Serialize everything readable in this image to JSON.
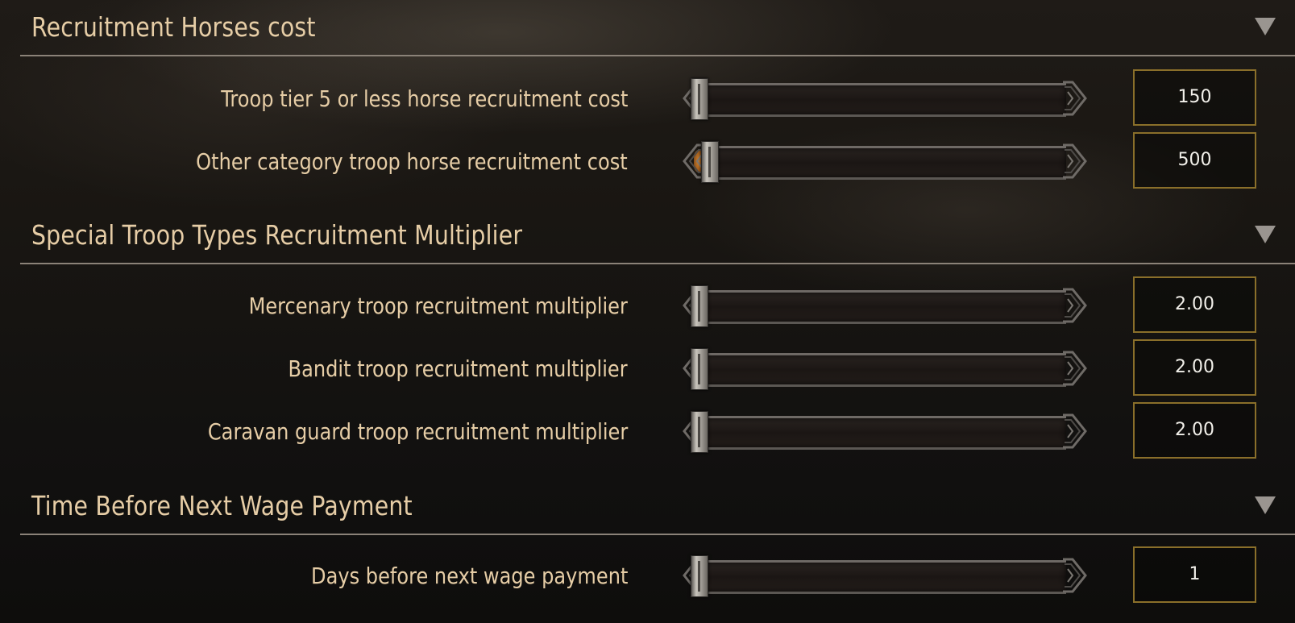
{
  "sections": [
    {
      "title": "Recruitment Horses cost",
      "rows": [
        {
          "label": "Troop tier 5 or less horse recruitment cost",
          "value": "150",
          "slider_fraction": 0.0
        },
        {
          "label": "Other category troop horse recruitment cost",
          "value": "500",
          "slider_fraction": 0.03
        }
      ]
    },
    {
      "title": "Special Troop Types Recruitment Multiplier",
      "rows": [
        {
          "label": "Mercenary troop recruitment multiplier",
          "value": "2.00",
          "slider_fraction": 0.0
        },
        {
          "label": "Bandit troop recruitment multiplier",
          "value": "2.00",
          "slider_fraction": 0.0
        },
        {
          "label": "Caravan guard troop recruitment multiplier",
          "value": "2.00",
          "slider_fraction": 0.0
        }
      ]
    },
    {
      "title": "Time Before Next Wage Payment",
      "rows": [
        {
          "label": "Days before next wage payment",
          "value": "1",
          "slider_fraction": 0.0
        }
      ]
    }
  ],
  "colors": {
    "label_text": "#e6cda6",
    "value_text": "#f2f0ea",
    "value_border": "#8a6f2a",
    "divider": "#8b8278",
    "slider_fill": "#c27728"
  },
  "icons": {
    "collapse": "triangle-down-icon",
    "slider_cap": "ornate-bracket-icon"
  }
}
